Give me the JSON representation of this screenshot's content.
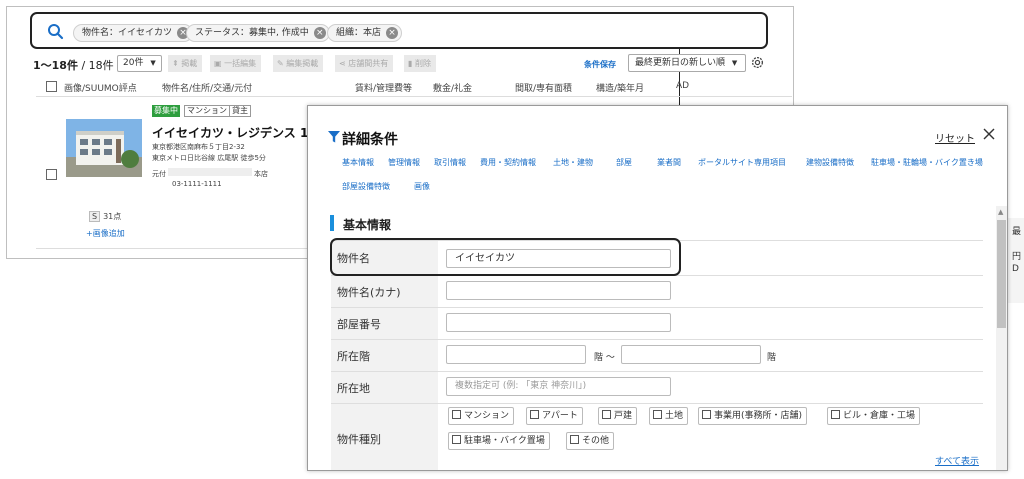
{
  "search": {
    "chips": [
      {
        "label": "物件名：イイセイカツ"
      },
      {
        "label": "ステータス：募集中, 作成中"
      },
      {
        "label": "組織：本店"
      }
    ]
  },
  "list": {
    "count_range": "1〜18件",
    "count_total": "/ 18件",
    "per_page": "20件",
    "toolbar": {
      "publish": "掲載",
      "bulk_edit": "一括編集",
      "edit_publish": "編集掲載",
      "store_share": "店舗間共有",
      "delete": "削除"
    },
    "save_condition": "条件保存",
    "sort": "最終更新日の新しい順",
    "columns": [
      "画像/SUUMO評点",
      "物件名/住所/交通/元付",
      "賃料/管理費等",
      "敷金/礼金",
      "間取/専有面積",
      "構造/築年月",
      "AD"
    ],
    "row": {
      "badges": {
        "status": "募集中",
        "type": "マンション",
        "owner": "貸主"
      },
      "name": "イイセイカツ・レジデンス 102",
      "address": "東京都港区南麻布５丁目2-32",
      "access": "東京メトロ日比谷線 広尾駅 徒歩5分",
      "agent_label": "元付",
      "agent_suffix": "本店",
      "phone": "03-1111-1111",
      "score_badge": "S",
      "score": "31点",
      "add_image": "+画像追加"
    }
  },
  "side": {
    "chars": [
      "最",
      "円",
      "D"
    ]
  },
  "modal": {
    "title": "詳細条件",
    "reset": "リセット",
    "tabs": [
      "基本情報",
      "管理情報",
      "取引情報",
      "費用・契約情報",
      "土地・建物",
      "部屋",
      "業者間",
      "ポータルサイト専用項目",
      "建物設備特徴",
      "駐車場・駐輪場・バイク置き場",
      "部屋設備特徴",
      "画像"
    ],
    "section": "基本情報",
    "fields": {
      "name_label": "物件名",
      "name_value": "イイセイカツ",
      "kana_label": "物件名(カナ)",
      "room_label": "部屋番号",
      "floor_label": "所在階",
      "floor_sep": "階 〜",
      "floor_unit": "階",
      "location_label": "所在地",
      "location_placeholder": "複数指定可 (例: 「東京 神奈川」)",
      "type_label": "物件種別",
      "types": [
        "マンション",
        "アパート",
        "戸建",
        "土地",
        "事業用(事務所・店舗)",
        "ビル・倉庫・工場",
        "駐車場・バイク置場",
        "その他"
      ],
      "show_all": "すべて表示"
    }
  }
}
